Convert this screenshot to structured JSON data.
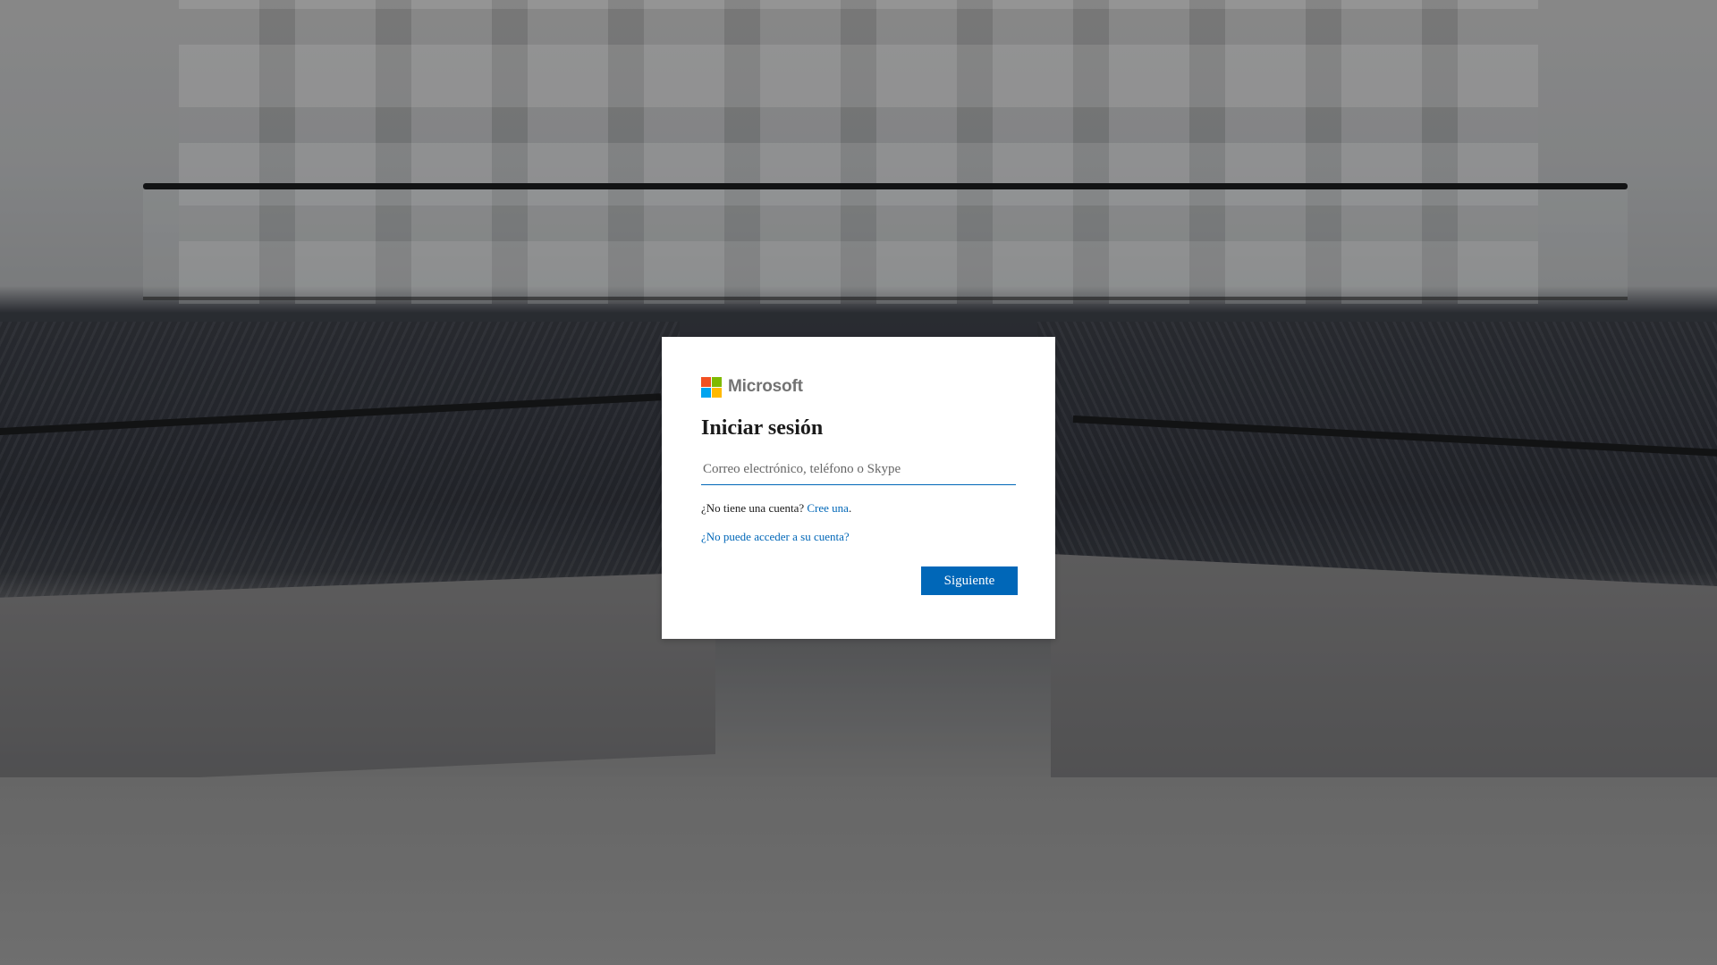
{
  "brand": {
    "name": "Microsoft",
    "logo_colors": [
      "#f25022",
      "#7fba00",
      "#00a4ef",
      "#ffb900"
    ],
    "accent": "#0067b8"
  },
  "signin": {
    "title": "Iniciar sesión",
    "email_placeholder": "Correo electrónico, teléfono o Skype",
    "email_value": "",
    "no_account_text": "¿No tiene una cuenta?",
    "create_link": "Cree una",
    "create_suffix": ".",
    "cant_access_link": "¿No puede acceder a su cuenta?",
    "next_button": "Siguiente"
  }
}
